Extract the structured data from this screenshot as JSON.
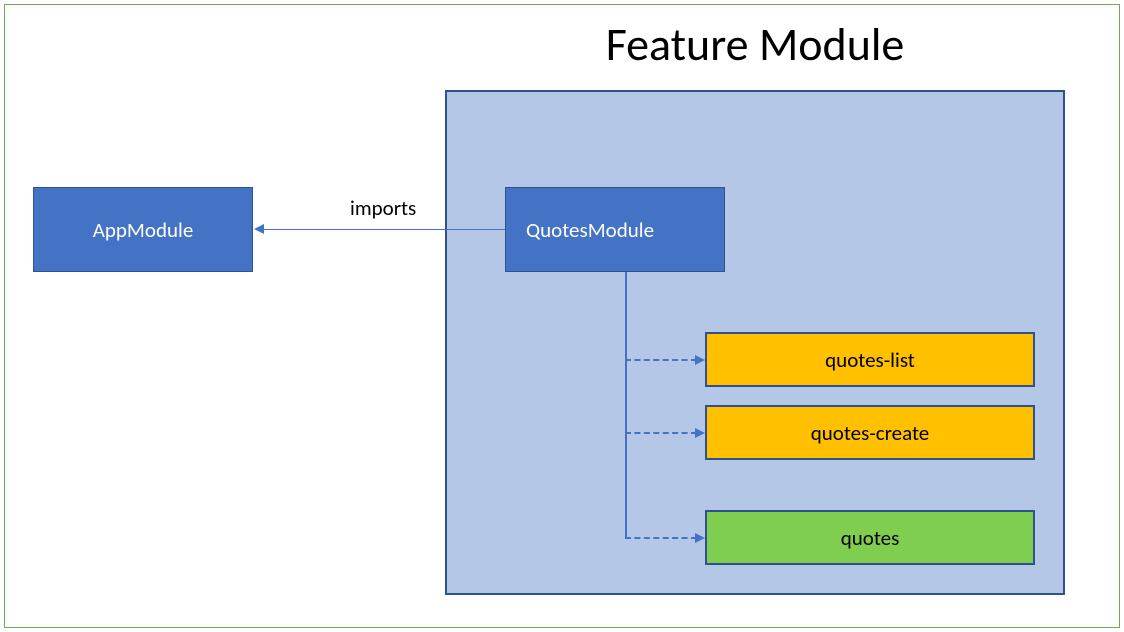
{
  "title": "Feature Module",
  "app_module": {
    "label": "AppModule"
  },
  "imports_label": "imports",
  "quotes_module": {
    "label": "QuotesModule"
  },
  "sub_modules": {
    "quotes_list": "quotes-list",
    "quotes_create": "quotes-create",
    "quotes": "quotes"
  },
  "colors": {
    "primary_blue": "#4472c4",
    "dark_blue": "#2f528f",
    "light_blue": "#b4c7e7",
    "yellow": "#ffc000",
    "green": "#7fce4f",
    "border_green": "#6fab52"
  }
}
